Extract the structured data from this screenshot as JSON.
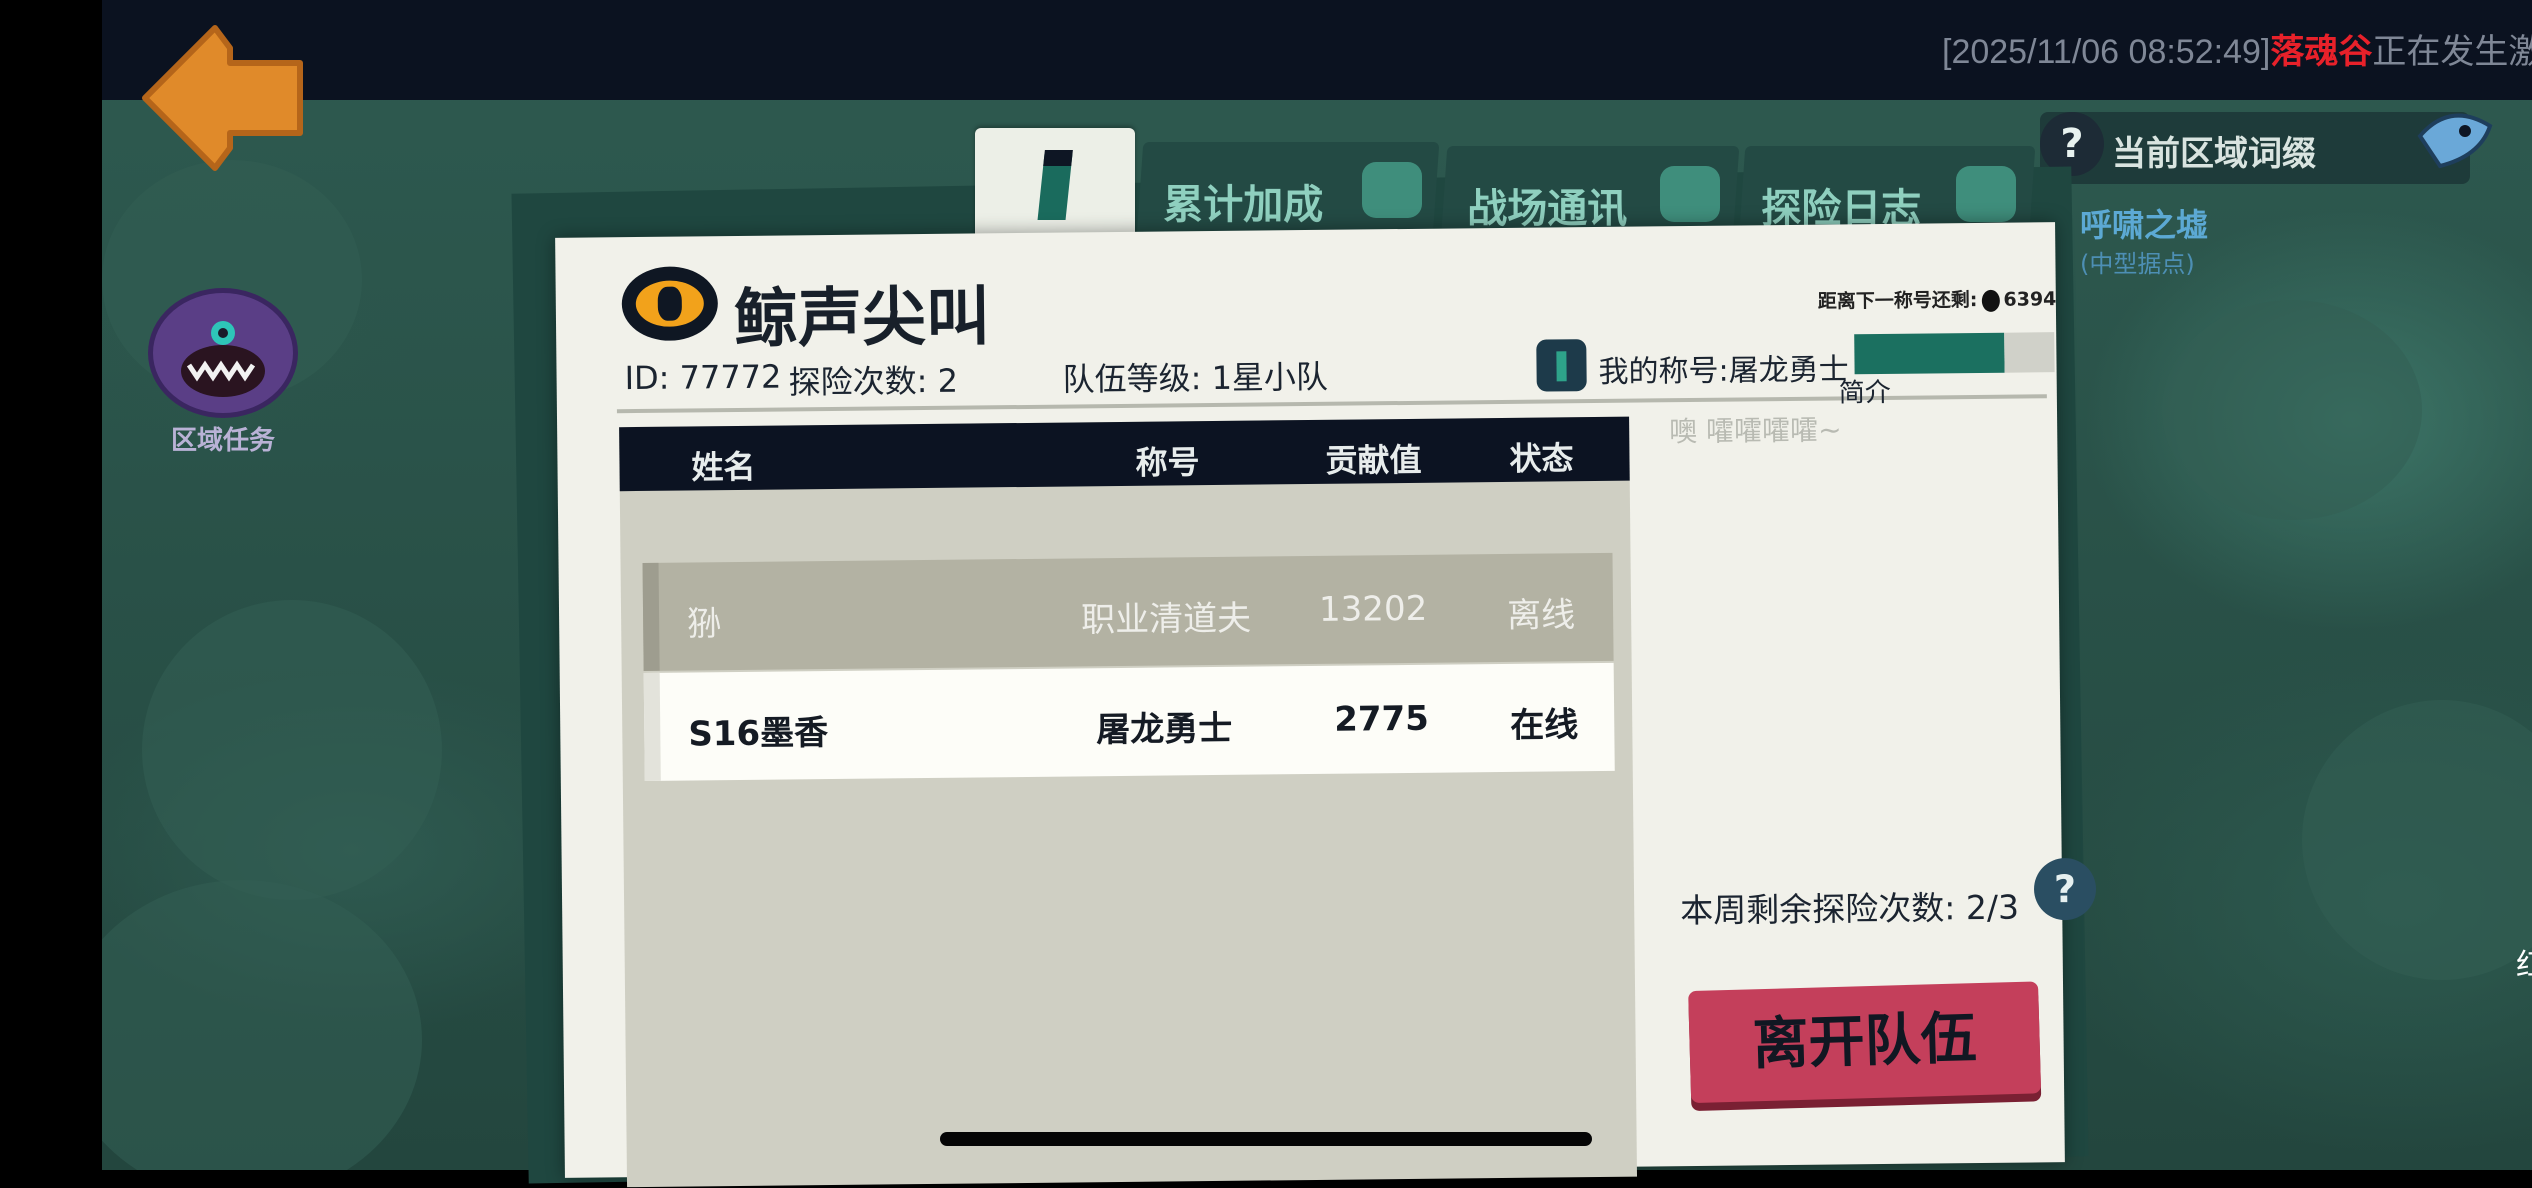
{
  "ticker": {
    "time": "[2025/11/06 08:52:49]",
    "location": "落魂谷",
    "message": "正在发生激烈的"
  },
  "left_hud": {
    "region_task_label": "区域任务"
  },
  "right_hud": {
    "region_affix_label": "当前区域词缀",
    "map_location": "呼啸之墟",
    "map_location_sub": "(中型据点)",
    "edge_text": "红"
  },
  "tabs": [
    {
      "label": "累计加成"
    },
    {
      "label": "战场通讯"
    },
    {
      "label": "探险日志"
    }
  ],
  "team": {
    "name": "鲸声尖叫",
    "id_text": "ID: 77772",
    "explore_count_text": "探险次数: 2",
    "team_level_text": "队伍等级: 1星小队"
  },
  "title_progress": {
    "label": "距离下一称号还剩:",
    "value": "6394",
    "my_title_text": "我的称号:屠龙勇士",
    "fill_fraction": 0.75
  },
  "intro": {
    "label": "简介",
    "text": "噢 嚯嚯嚯嚯~"
  },
  "table": {
    "headers": [
      "姓名",
      "称号",
      "贡献值",
      "状态"
    ],
    "rows": [
      {
        "name": "狲",
        "title": "职业清道夫",
        "contribution": "13202",
        "status": "离线"
      },
      {
        "name": "S16墨香",
        "title": "屠龙勇士",
        "contribution": "2775",
        "status": "在线"
      }
    ]
  },
  "weekly": {
    "remaining_text": "本周剩余探险次数:",
    "remaining_value": "2/3"
  },
  "buttons": {
    "leave_team": "离开队伍",
    "help": "?",
    "affix_help": "?"
  },
  "colors": {
    "leave_button": "#c43f5b",
    "accent_teal": "#1b7060",
    "header_bg": "#0c1322"
  }
}
